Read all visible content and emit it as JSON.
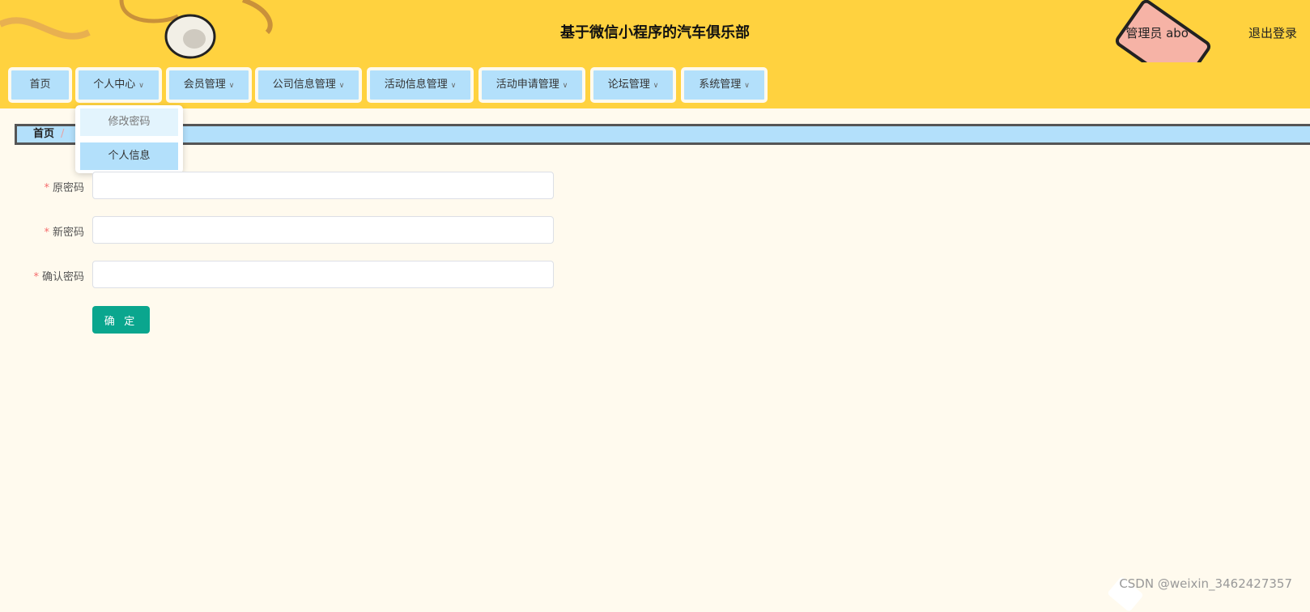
{
  "header": {
    "title": "基于微信小程序的汽车俱乐部",
    "user_info": "管理员 abo",
    "logout_label": "退出登录"
  },
  "nav": {
    "items": [
      {
        "label": "首页"
      },
      {
        "label": "个人中心"
      },
      {
        "label": "会员管理"
      },
      {
        "label": "公司信息管理"
      },
      {
        "label": "活动信息管理"
      },
      {
        "label": "活动申请管理"
      },
      {
        "label": "论坛管理"
      },
      {
        "label": "系统管理"
      }
    ]
  },
  "dropdown": {
    "items": [
      {
        "label": "修改密码"
      },
      {
        "label": "个人信息"
      }
    ]
  },
  "breadcrumb": {
    "home": "首页",
    "separator": "/"
  },
  "form": {
    "fields": [
      {
        "label": "原密码",
        "required": "*",
        "value": ""
      },
      {
        "label": "新密码",
        "required": "*",
        "value": ""
      },
      {
        "label": "确认密码",
        "required": "*",
        "value": ""
      }
    ],
    "submit_label": "确 定"
  },
  "watermark": "CSDN @weixin_3462427357",
  "colors": {
    "header_bg": "#ffd23f",
    "nav_item_bg": "#b3e0fb",
    "page_bg": "#fffaee",
    "primary_button": "#0aa68e",
    "required_mark": "#f56c6c"
  }
}
